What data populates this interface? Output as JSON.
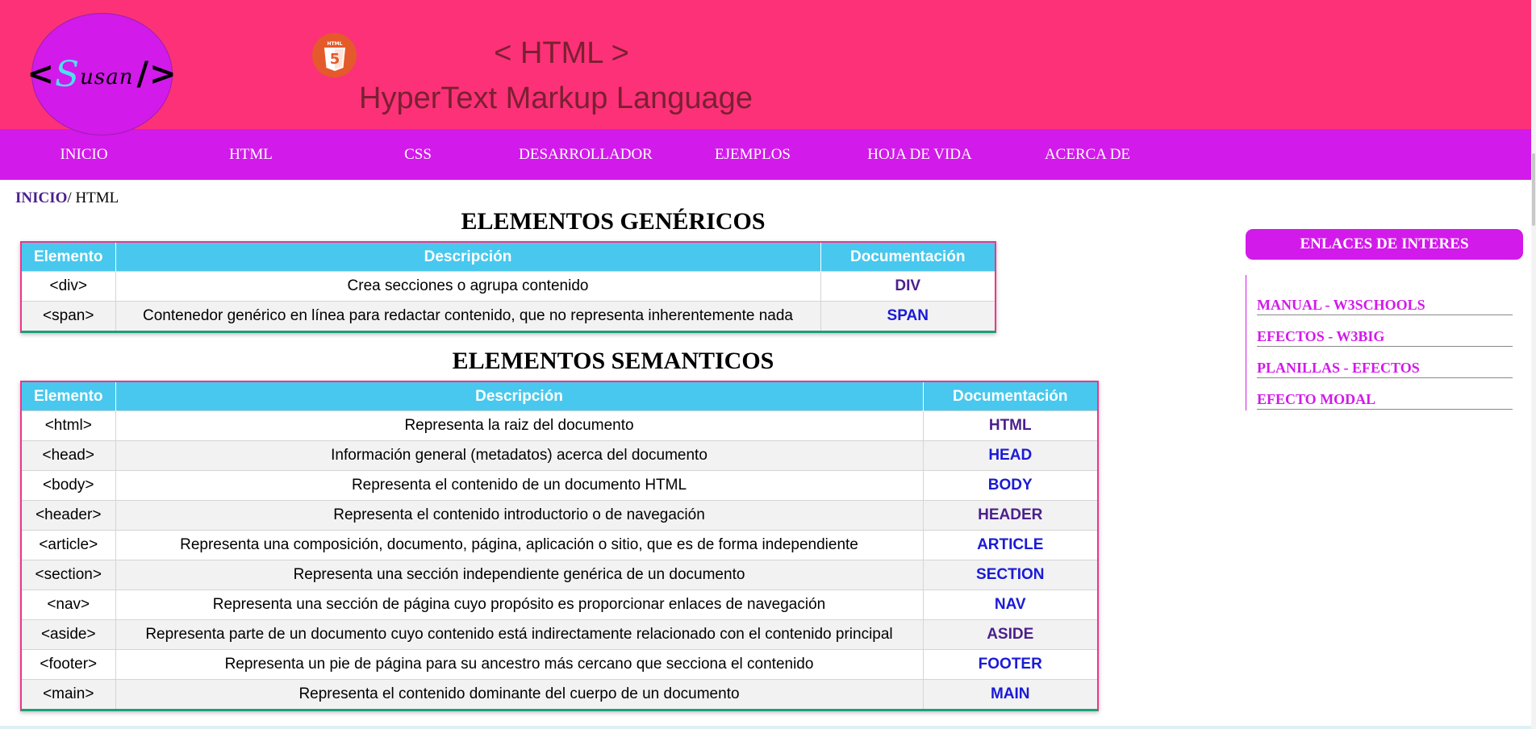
{
  "header": {
    "logo": {
      "lt": "<",
      "s": "S",
      "usan": "usan",
      "gt": "/>"
    },
    "title": "< HTML >",
    "subtitle": "HyperText Markup Language",
    "html5_badge": "HTML"
  },
  "nav": {
    "items": [
      {
        "label": "INICIO"
      },
      {
        "label": "HTML"
      },
      {
        "label": "CSS"
      },
      {
        "label": "DESARROLLADOR"
      },
      {
        "label": "EJEMPLOS"
      },
      {
        "label": "HOJA DE VIDA"
      },
      {
        "label": "ACERCA DE"
      }
    ]
  },
  "breadcrumb": {
    "home": "INICIO",
    "separator": "/ ",
    "current": "HTML"
  },
  "generic": {
    "title": "ELEMENTOS GENÉRICOS",
    "headers": [
      "Elemento",
      "Descripción",
      "Documentación"
    ],
    "rows": [
      {
        "element": "<div>",
        "description": "Crea secciones o agrupa contenido",
        "doc": "DIV",
        "doc_color": "purple"
      },
      {
        "element": "<span>",
        "description": "Contenedor genérico en línea para redactar contenido, que no representa inherentemente nada",
        "doc": "SPAN",
        "doc_color": "blue"
      }
    ]
  },
  "semantic": {
    "title": "ELEMENTOS SEMANTICOS",
    "headers": [
      "Elemento",
      "Descripción",
      "Documentación"
    ],
    "rows": [
      {
        "element": "<html>",
        "description": "Representa la raiz del documento",
        "doc": "HTML",
        "doc_color": "purple"
      },
      {
        "element": "<head>",
        "description": "Información general (metadatos) acerca del documento",
        "doc": "HEAD",
        "doc_color": "blue"
      },
      {
        "element": "<body>",
        "description": "Representa el contenido de un documento HTML",
        "doc": "BODY",
        "doc_color": "blue"
      },
      {
        "element": "<header>",
        "description": "Representa el contenido introductorio o de navegación",
        "doc": "HEADER",
        "doc_color": "purple"
      },
      {
        "element": "<article>",
        "description": "Representa una composición, documento, página, aplicación o sitio, que es de forma independiente",
        "doc": "ARTICLE",
        "doc_color": "blue"
      },
      {
        "element": "<section>",
        "description": "Representa una sección independiente genérica de un documento",
        "doc": "SECTION",
        "doc_color": "blue"
      },
      {
        "element": "<nav>",
        "description": "Representa una sección de página cuyo propósito es proporcionar enlaces de navegación",
        "doc": "NAV",
        "doc_color": "blue"
      },
      {
        "element": "<aside>",
        "description": "Representa parte de un documento cuyo contenido está indirectamente relacionado con el contenido principal",
        "doc": "ASIDE",
        "doc_color": "purple"
      },
      {
        "element": "<footer>",
        "description": "Representa un pie de página para su ancestro más cercano que secciona el contenido",
        "doc": "FOOTER",
        "doc_color": "blue"
      },
      {
        "element": "<main>",
        "description": "Representa el contenido dominante del cuerpo de un documento",
        "doc": "MAIN",
        "doc_color": "blue"
      }
    ]
  },
  "sidebar": {
    "title": "ENLACES DE INTERES",
    "links": [
      {
        "label": "MANUAL - W3SCHOOLS"
      },
      {
        "label": "EFECTOS - W3BIG"
      },
      {
        "label": "PLANILLAS - EFECTOS"
      },
      {
        "label": "EFECTO MODAL"
      }
    ]
  },
  "colors": {
    "header_bg": "#fd3178",
    "nav_bg": "#d21aea",
    "table_header_bg": "#48c8ee",
    "table_border": "#f0348c",
    "table_bottom_border": "#1f9e7a",
    "doc_blue": "#1a1ad6",
    "doc_purple": "#4b1f8c",
    "sidebar_accent": "#d21aea"
  },
  "icons": {
    "html5_badge": "html5-icon"
  }
}
